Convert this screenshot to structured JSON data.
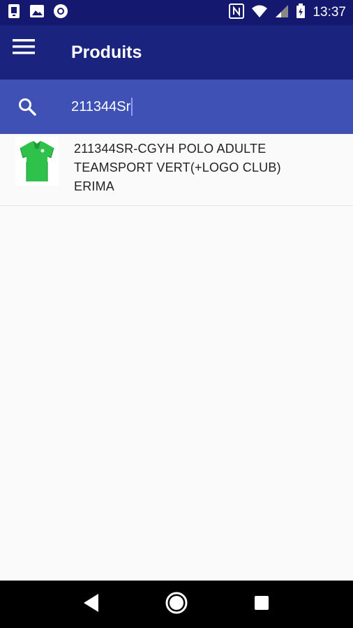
{
  "status_bar": {
    "time": "13:37",
    "left_icons": [
      "sim-app-icon",
      "image-icon",
      "sync-circle-icon"
    ],
    "right_icons": [
      "nfc-icon",
      "wifi-icon",
      "signal-icon",
      "battery-charging-icon"
    ]
  },
  "app_bar": {
    "title": "Produits",
    "menu_icon": "hamburger-menu-icon"
  },
  "search": {
    "value": "211344Sr",
    "icon": "search-icon"
  },
  "results": [
    {
      "line1": "211344SR-CGYH POLO ADULTE",
      "line2": "TEAMSPORT VERT(+LOGO CLUB)",
      "line3": "ERIMA",
      "thumbnail": "green-polo-shirt-image"
    }
  ],
  "nav_bar": {
    "buttons": [
      "back-icon",
      "home-icon",
      "recents-icon"
    ]
  },
  "colors": {
    "status_bar": "#14186e",
    "app_bar": "#1a237e",
    "search_bar": "#3f51b5",
    "background": "#fafafa"
  }
}
